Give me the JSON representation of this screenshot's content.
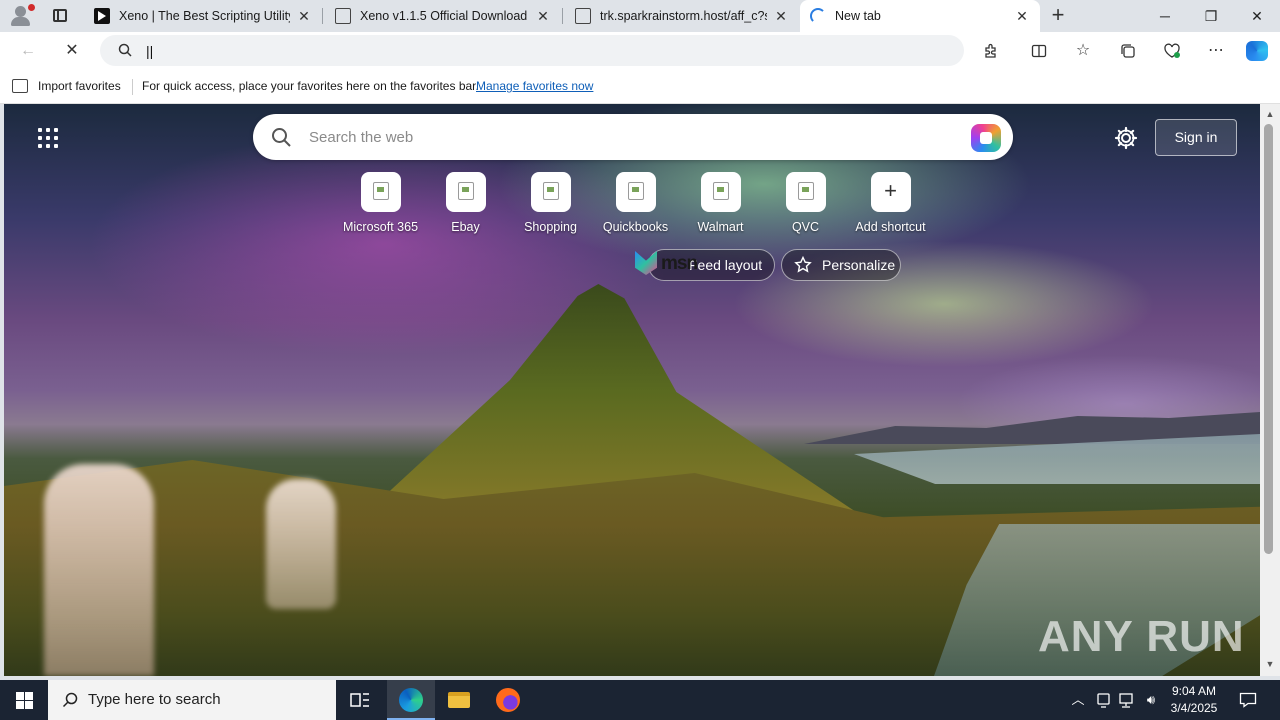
{
  "tabs": [
    {
      "title": "Xeno | The Best Scripting Utility",
      "favicon": "xeno-logo-icon"
    },
    {
      "title": "Xeno v1.1.5 Official Download",
      "favicon": "document-icon"
    },
    {
      "title": "trk.sparkrainstorm.host/aff_c?source=...",
      "favicon": "document-icon"
    },
    {
      "title": "New tab",
      "favicon": "loading-icon",
      "active": true
    }
  ],
  "toolbar": {
    "address_value": "||"
  },
  "favorites_bar": {
    "import_label": "Import favorites",
    "hint": "For quick access, place your favorites here on the favorites bar.",
    "manage_link": "Manage favorites now"
  },
  "newtab": {
    "search_placeholder": "Search the web",
    "sign_in": "Sign in",
    "shortcuts": [
      {
        "label": "Microsoft 365"
      },
      {
        "label": "Ebay"
      },
      {
        "label": "Shopping"
      },
      {
        "label": "Quickbooks"
      },
      {
        "label": "Walmart"
      },
      {
        "label": "QVC"
      },
      {
        "label": "Add shortcut"
      }
    ],
    "msn_logo": "msn",
    "feed_layout": "Feed layout",
    "personalize": "Personalize"
  },
  "watermark": "ANY RUN",
  "taskbar": {
    "search_text": "Type here to search",
    "time": "9:04 AM",
    "date": "3/4/2025"
  },
  "colors": {
    "accent": "#0f5fb8",
    "taskbar": "#1b2433"
  }
}
